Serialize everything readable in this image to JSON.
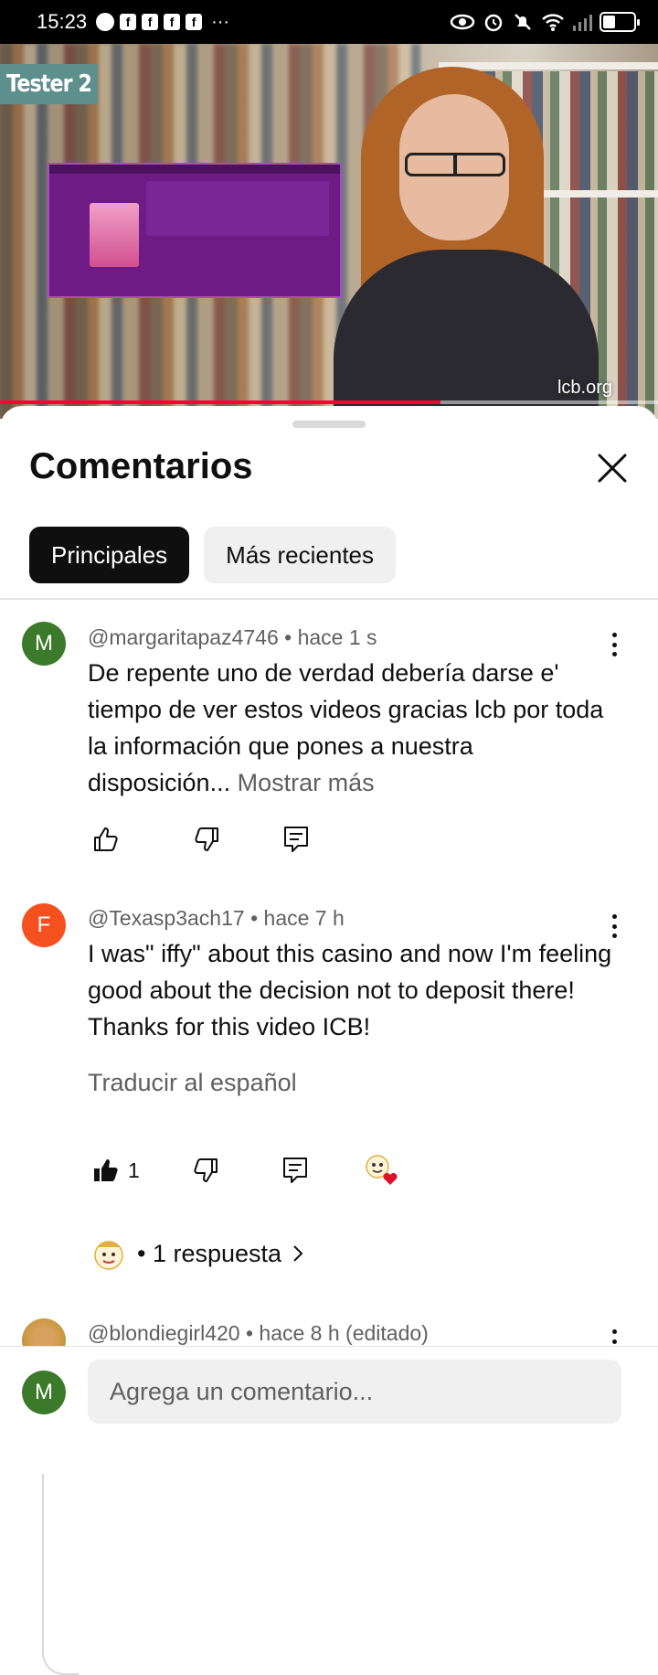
{
  "status_bar": {
    "time": "15:23",
    "notification_icons": [
      "messenger-icon",
      "facebook-icon",
      "facebook-icon",
      "facebook-icon",
      "facebook-icon"
    ],
    "more": "···",
    "battery_level": 0.4
  },
  "video": {
    "badge": "Tester 2",
    "watermark": "lcb.org",
    "progress": 0.67
  },
  "sheet": {
    "title": "Comentarios",
    "chips": [
      {
        "label": "Principales",
        "active": true
      },
      {
        "label": "Más recientes",
        "active": false
      }
    ]
  },
  "comments": [
    {
      "avatar_letter": "M",
      "avatar_color": "#3b7a2a",
      "handle": "@margaritapaz4746",
      "time": "hace 1 s",
      "text": "De repente uno de verdad debería darse e' tiempo de ver estos videos gracias lcb por toda la información que pones a nuestra disposición...",
      "more_label": "Mostrar más"
    },
    {
      "avatar_letter": "F",
      "avatar_color": "#f4511e",
      "handle": "@Texasp3ach17",
      "time": "hace 7 h",
      "text": "I was\" iffy\" about this casino and now I'm feeling good about the decision not to deposit there! Thanks for this video ICB!",
      "translate_label": "Traducir al español",
      "like_count": "1",
      "replies_label": "• 1 respuesta"
    },
    {
      "handle": "@blondiegirl420",
      "time": "hace 8 h (editado)"
    }
  ],
  "footer": {
    "avatar_letter": "M",
    "avatar_color": "#3b7a2a",
    "input_placeholder": "Agrega un comentario..."
  }
}
